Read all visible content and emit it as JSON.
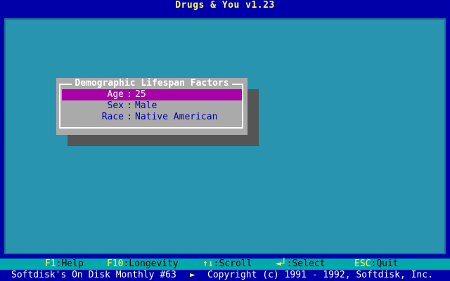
{
  "app": {
    "title": "Drugs & You v1.23"
  },
  "dialog": {
    "title": "Demographic Lifespan Factors",
    "rows": [
      {
        "label": "Age",
        "value": "25",
        "selected": true
      },
      {
        "label": "Sex",
        "value": "Male",
        "selected": false
      },
      {
        "label": "Race",
        "value": "Native American",
        "selected": false
      }
    ],
    "separator": ":"
  },
  "help_bar": [
    {
      "key": "F1",
      "action": "Help"
    },
    {
      "key": "F10",
      "action": "Longevity"
    },
    {
      "key": "↑↓",
      "action": "Scroll"
    },
    {
      "key": "◄┘",
      "action": "Select"
    },
    {
      "key": "ESC",
      "action": "Quit"
    }
  ],
  "status_bar": {
    "left": "Softdisk's On Disk Monthly #63",
    "arrow": "►",
    "right": "Copyright (c) 1991 - 1992, Softdisk, Inc."
  },
  "colors": {
    "title_bg": "#0000aa",
    "title_fg": "#ffff55",
    "desktop": "#2e9db7",
    "dialog_bg": "#aaaaaa",
    "highlight": "#aa00aa",
    "help_bar_bg": "#00aaaa",
    "help_key": "#ffff55"
  }
}
